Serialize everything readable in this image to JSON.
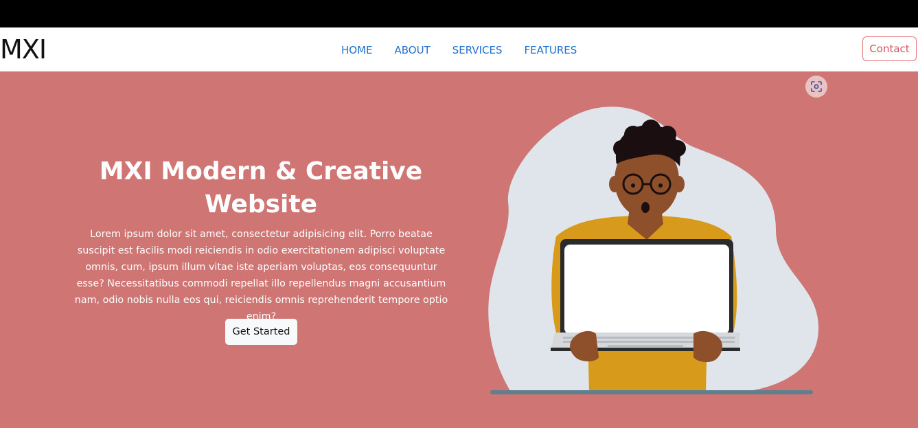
{
  "navbar": {
    "brand": "MXI",
    "links": [
      {
        "label": "HOME"
      },
      {
        "label": "ABOUT"
      },
      {
        "label": "SERVICES"
      },
      {
        "label": "FEATURES"
      }
    ],
    "contact_label": "Contact"
  },
  "hero": {
    "title": "MXI Modern & Creative Website",
    "description": "Lorem ipsum dolor sit amet, consectetur adipisicing elit. Porro beatae suscipit est facilis modi reiciendis in odio exercitationem adipisci voluptate omnis, cum, ipsum illum vitae iste aperiam voluptas, eos consequuntur esse? Necessitatibus commodi repellat illo repellendus magni accusantium nam, odio nobis nulla eos qui, reiciendis omnis reprehenderit tempore optio enim?",
    "cta_label": "Get Started",
    "background_color": "#cf7574"
  },
  "icons": {
    "scan": "scan-screen-icon",
    "illustration": "person-holding-laptop-illustration"
  },
  "colors": {
    "nav_link": "#1f6fd1",
    "contact": "#d9535b",
    "topbar": "#000000"
  }
}
